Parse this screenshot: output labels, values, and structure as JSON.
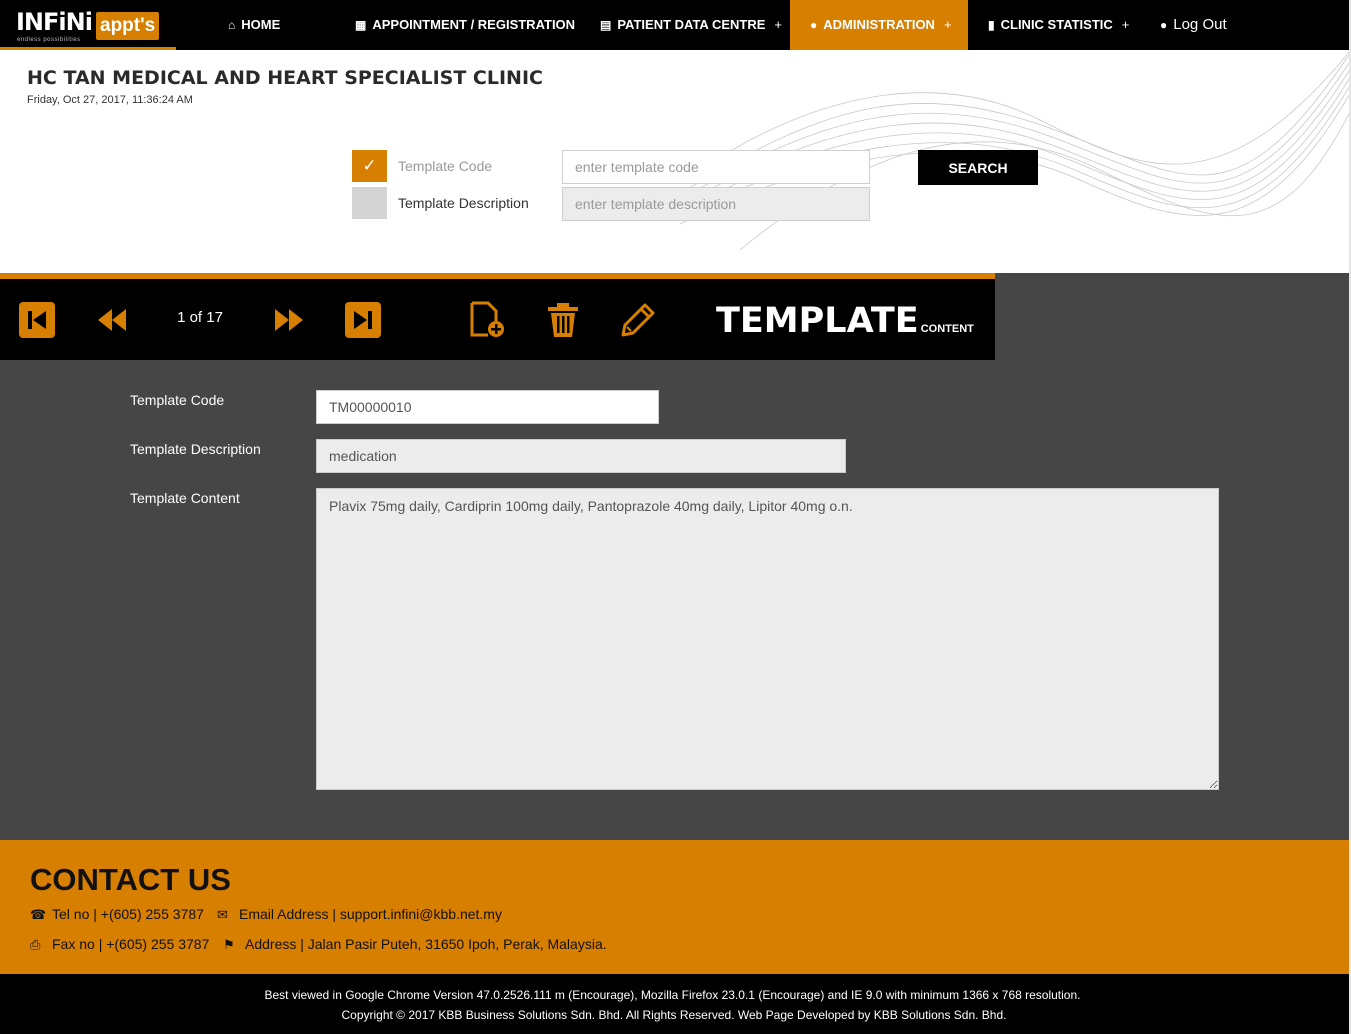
{
  "brand": {
    "name_part1": "INFiNi",
    "name_part2": "appt's",
    "tagline": "endless possibilities"
  },
  "nav": {
    "items": [
      {
        "label": "HOME",
        "icon": "home-icon"
      },
      {
        "label": "APPOINTMENT / REGISTRATION",
        "icon": "calendar-icon"
      },
      {
        "label": "PATIENT DATA CENTRE",
        "icon": "book-icon",
        "expand": "+"
      },
      {
        "label": "ADMINISTRATION",
        "icon": "user-icon",
        "expand": "+",
        "active": true
      },
      {
        "label": "CLINIC STATISTIC",
        "icon": "bar-chart-icon",
        "expand": "+"
      }
    ],
    "logout_label": "Log Out"
  },
  "header": {
    "clinic_name": "HC TAN MEDICAL AND HEART SPECIALIST CLINIC",
    "datetime": "Friday, Oct 27, 2017, 11:36:24 AM"
  },
  "search": {
    "code_label": "Template Code",
    "code_checked": true,
    "code_placeholder": "enter template code",
    "desc_label": "Template Description",
    "desc_checked": false,
    "desc_placeholder": "enter template description",
    "button_label": "SEARCH"
  },
  "toolbar": {
    "page_indicator": "1 of 17",
    "title": "TEMPLATE",
    "subtitle": "CONTENT"
  },
  "form": {
    "code_label": "Template Code",
    "code_value": "TM00000010",
    "desc_label": "Template Description",
    "desc_value": "medication",
    "content_label": "Template Content",
    "content_value": "Plavix 75mg daily, Cardiprin 100mg daily, Pantoprazole 40mg daily, Lipitor 40mg o.n."
  },
  "contact": {
    "title": "CONTACT US",
    "tel": "Tel no | +(605) 255 3787",
    "email": "Email Address | support.infini@kbb.net.my",
    "fax": "Fax no | +(605) 255 3787",
    "address": "Address | Jalan Pasir Puteh, 31650 Ipoh, Perak, Malaysia."
  },
  "footer": {
    "line1": "Best viewed in Google Chrome Version 47.0.2526.111 m (Encourage), Mozilla Firefox 23.0.1 (Encourage) and IE 9.0 with minimum 1366 x 768 resolution.",
    "line2": "Copyright © 2017 KBB Business Solutions Sdn. Bhd. All Rights Reserved. Web Page Developed by KBB Solutions Sdn. Bhd."
  },
  "colors": {
    "accent": "#d77f00",
    "dark": "#464646",
    "black": "#000000"
  }
}
